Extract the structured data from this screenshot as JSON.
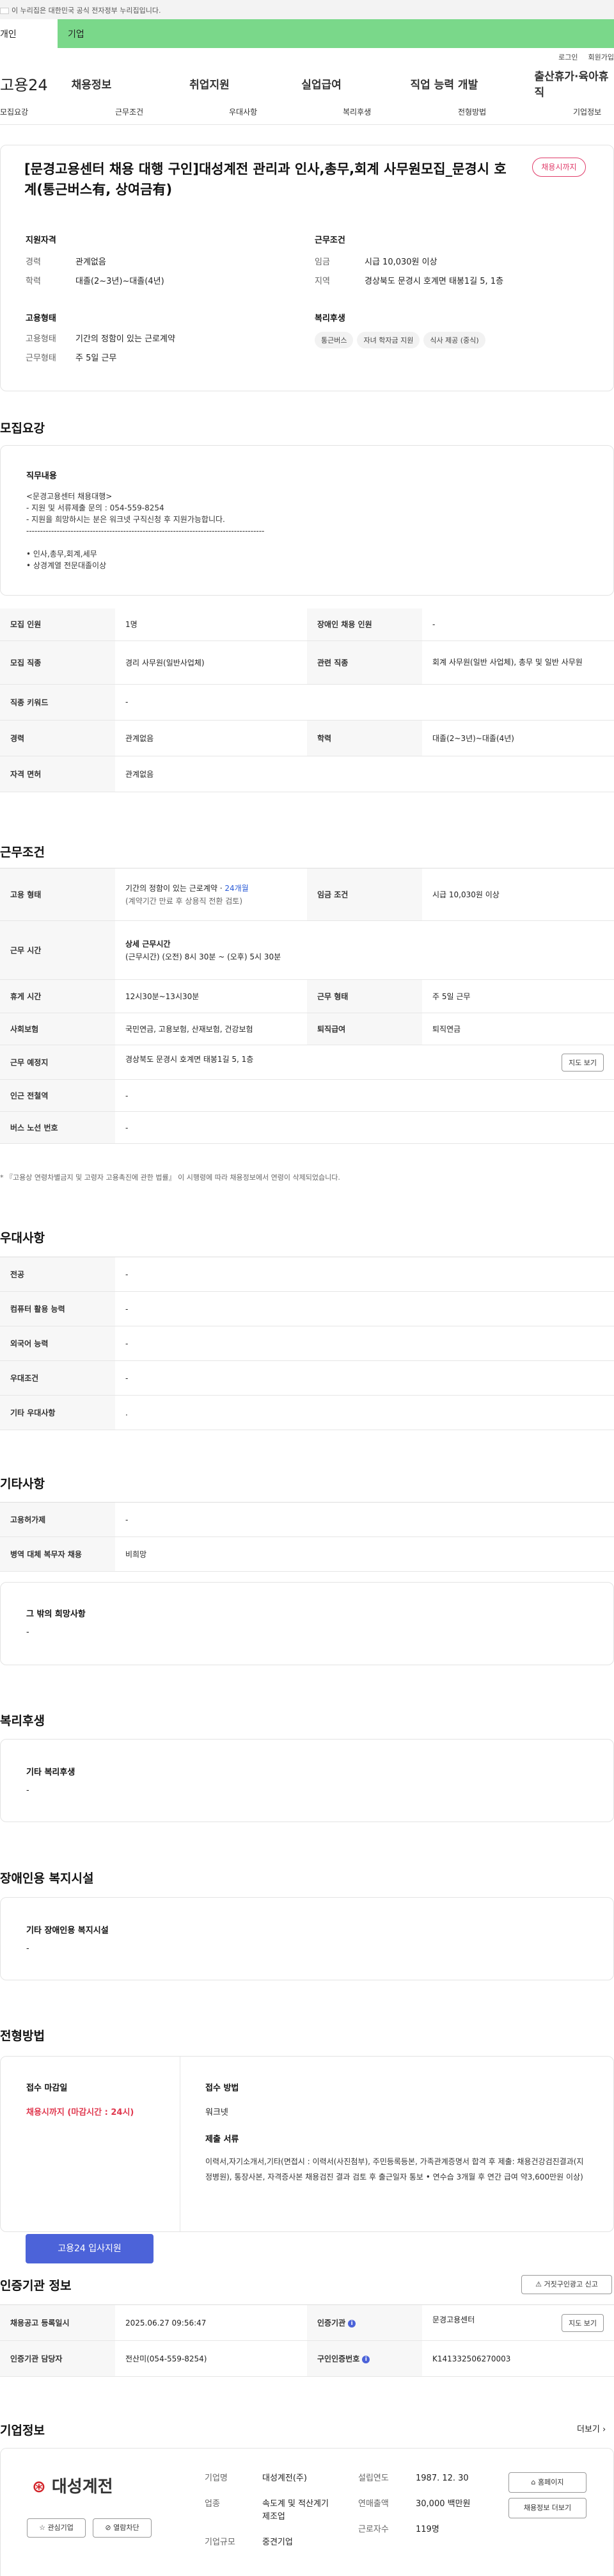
{
  "gov_banner": "이 누리집은 대한민국 공식 전자정부 누리집입니다.",
  "top_tabs": [
    "개인",
    "기업"
  ],
  "util": [
    "로그인",
    "회원가입"
  ],
  "logo": "고용24",
  "gnb": [
    "채용정보",
    "취업지원",
    "실업급여",
    "직업 능력 개발",
    "출산휴가·육아휴직"
  ],
  "snb": [
    "모집요강",
    "근무조건",
    "우대사항",
    "복리후생",
    "전형방법",
    "기업정보"
  ],
  "header": {
    "title": "[문경고용센터 채용 대행 구인]대성계전 관리과 인사,총무,회계 사무원모집_문경시 호계(통근버스有, 상여금有)",
    "badge": "채용시까지",
    "qual_h": "지원자격",
    "cond_h": "근무조건",
    "career_k": "경력",
    "career_v": "관계없음",
    "edu_k": "학력",
    "edu_v": "대졸(2~3년)~대졸(4년)",
    "wage_k": "임금",
    "wage_v": "시급 10,030원 이상",
    "loc_k": "지역",
    "loc_v": "경상북도 문경시 호계면 태봉1길 5, 1층",
    "form_h": "고용형태",
    "emp_k": "고용형태",
    "emp_v": "기간의 정함이 있는 근로계약",
    "wf_k": "근무형태",
    "wf_v": "주 5일 근무",
    "wel_h": "복리후생",
    "chips": [
      "통근버스",
      "자녀 학자금 지원",
      "식사 제공 (중식)"
    ]
  },
  "recruit": {
    "h": "모집요강",
    "duty_h": "직무내용",
    "duty": [
      "<문경고용센터 채용대행>",
      "- 지원 및 서류제출 문의 : 054-559-8254",
      "- 지원을 희망하시는 분은 워크넷 구직신청 후 지원가능합니다.",
      "--------------------------------------------------------------------------------------",
      "",
      "• 인사,총무,회계,세무",
      "• 상경계열 전문대졸이상"
    ],
    "rows": [
      [
        "모집 인원",
        "1명",
        "장애인 채용 인원",
        "-"
      ],
      [
        "모집 직종",
        "경리 사무원(일반사업체)",
        "관련 직종",
        "회계 사무원(일반 사업체), 총무 및 일반 사무원"
      ],
      [
        "직종 키워드",
        "-",
        "",
        ""
      ],
      [
        "경력",
        "관계없음",
        "학력",
        "대졸(2~3년)~대졸(4년)"
      ],
      [
        "자격 면허",
        "관계없음",
        "",
        ""
      ]
    ]
  },
  "work": {
    "h": "근무조건",
    "emp_k": "고용 형태",
    "emp_v1": "기간의 정함이 있는 근로계약 · ",
    "emp_v1b": "24개월",
    "emp_v2": "(계약기간 만료 후 상용직 전환 검토)",
    "wage_k": "임금 조건",
    "wage_v": "시급 10,030원 이상",
    "time_k": "근무 시간",
    "time_h": "상세 근무시간",
    "time_v": "(근무시간) (오전) 8시 30분 ~ (오후) 5시 30분",
    "rest_k": "휴게 시간",
    "rest_v": "12시30분~13시30분",
    "form_k": "근무 형태",
    "form_v": "주 5일 근무",
    "ins_k": "사회보험",
    "ins_v": "국민연금, 고용보험, 산재보험, 건강보험",
    "ret_k": "퇴직급여",
    "ret_v": "퇴직연금",
    "place_k": "근무 예정지",
    "place_v": "경상북도 문경시 호계면 태봉1길 5, 1층",
    "map_btn": "지도 보기",
    "sub_k": "인근 전철역",
    "sub_v": "-",
    "bus_k": "버스 노선 번호",
    "bus_v": "-",
    "note": "* 『고용상 연령차별금지 및 고령자 고용촉진에 관한 법률』 이 시행령에 따라 채용정보에서 연령이 삭제되었습니다."
  },
  "pref": {
    "h": "우대사항",
    "rows": [
      [
        "전공",
        "-"
      ],
      [
        "컴퓨터 활용 능력",
        "-"
      ],
      [
        "외국어 능력",
        "-"
      ],
      [
        "우대조건",
        "-"
      ],
      [
        "기타 우대사항",
        "."
      ]
    ]
  },
  "etc": {
    "h": "기타사항",
    "rows": [
      [
        "고용허가제",
        "-"
      ],
      [
        "병역 대체 복무자 채용",
        "비희망"
      ]
    ],
    "other_h": "그 밖의 희망사항",
    "other_v": "-"
  },
  "welfare": {
    "h": "복리후생",
    "lbl": "기타 복리후생",
    "v": "-"
  },
  "disab": {
    "h": "장애인용 복지시설",
    "lbl": "기타 장애인용 복지시설",
    "v": "-"
  },
  "sel": {
    "h": "전형방법",
    "deadline_h": "접수 마감일",
    "deadline_v": "채용시까지 (마감시간 : 24시)",
    "apply_btn": "고용24 입사지원",
    "method_h": "접수 방법",
    "method_v": "워크넷",
    "docs_h": "제출 서류",
    "docs_v": "이력서,자기소개서,기타(면접시 : 이력서(사진첨부), 주민등록등본, 가족관계증명서 합격 후 제출: 채용건강검진결과(지정병원), 통장사본, 자격증사본 채용검진 결과 검토 후 출근일자 통보 • 연수습 3개월 후 연간 급여 약3,600만원 이상)"
  },
  "agency": {
    "h": "인증기관 정보",
    "report_btn": "거짓구인광고 신고",
    "rows": [
      [
        "채용공고 등록일시",
        "2025.06.27 09:56:47",
        "인증기관",
        "문경고용센터"
      ],
      [
        "인증기관 담당자",
        "전산미(054-559-8254)",
        "구인인증번호",
        "K141332506270003"
      ]
    ],
    "map_btn": "지도 보기"
  },
  "company": {
    "h": "기업정보",
    "more": "더보기",
    "name": "대성계전",
    "fav": "관심기업",
    "block": "열람차단",
    "k1": "기업명",
    "v1": "대성계전(주)",
    "k2": "업종",
    "v2": "속도계 및 적산계기 제조업",
    "k3": "기업규모",
    "v3": "중견기업",
    "k4": "설립연도",
    "v4": "1987. 12. 30",
    "k5": "연매출액",
    "v5": "30,000 백만원",
    "k6": "근로자수",
    "v6": "119명",
    "home": "홈페이지",
    "jobs": "채용정보 더보기"
  },
  "colors": {
    "accent": "#4c63d9",
    "green": "#7ad88a",
    "red": "#e0394f"
  }
}
